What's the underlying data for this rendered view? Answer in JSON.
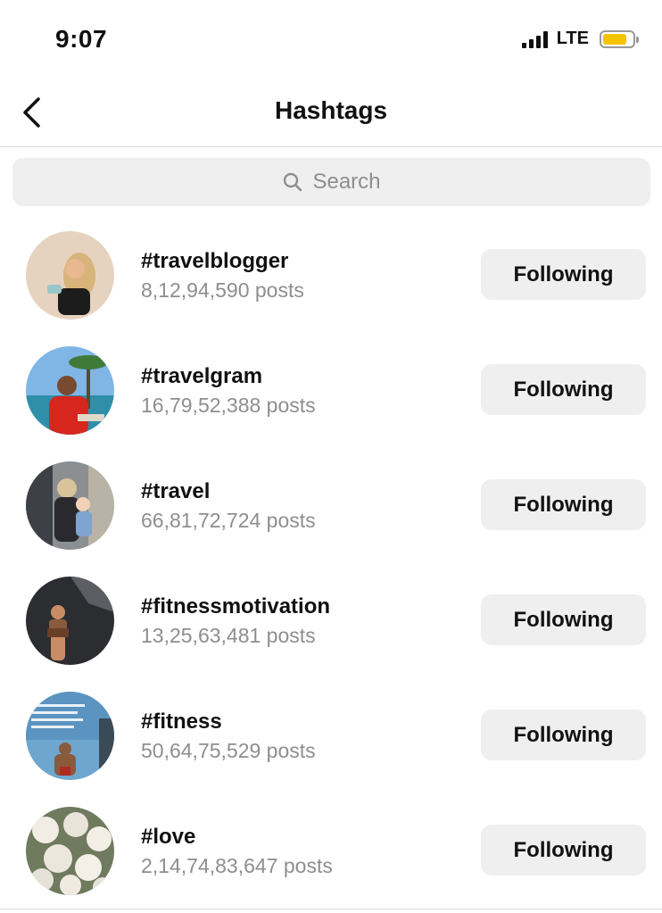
{
  "status_bar": {
    "time": "9:07",
    "network": "LTE",
    "battery_color": "#f5c400"
  },
  "header": {
    "title": "Hashtags",
    "back_icon": "chevron-left-icon"
  },
  "search": {
    "placeholder": "Search",
    "icon": "search-icon"
  },
  "hashtags": [
    {
      "tag": "#travelblogger",
      "posts": "8,12,94,590 posts",
      "button": "Following"
    },
    {
      "tag": "#travelgram",
      "posts": "16,79,52,388 posts",
      "button": "Following"
    },
    {
      "tag": "#travel",
      "posts": "66,81,72,724 posts",
      "button": "Following"
    },
    {
      "tag": "#fitnessmotivation",
      "posts": "13,25,63,481 posts",
      "button": "Following"
    },
    {
      "tag": "#fitness",
      "posts": "50,64,75,529 posts",
      "button": "Following"
    },
    {
      "tag": "#love",
      "posts": "2,14,74,83,647 posts",
      "button": "Following"
    }
  ],
  "colors": {
    "button_bg": "#efefef",
    "secondary_text": "#8e8e8e",
    "divider": "#dbdbdb"
  }
}
